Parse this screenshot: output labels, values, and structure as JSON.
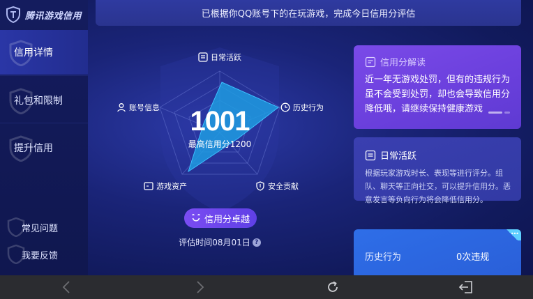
{
  "app": {
    "brand_name": "腾讯游戏信用"
  },
  "banner": {
    "text": "已根据你QQ账号下的在玩游戏，完成今日信用分评估"
  },
  "sidebar": {
    "items": [
      {
        "label": "信用详情",
        "active": true
      },
      {
        "label": "礼包和限制",
        "active": false
      },
      {
        "label": "提升信用",
        "active": false
      }
    ],
    "bottom_links": [
      {
        "label": "常见问题"
      },
      {
        "label": "我要反馈"
      }
    ]
  },
  "radar": {
    "score": "1001",
    "max_label": "最高信用分1200",
    "axes": [
      {
        "label": "日常活跃",
        "icon": "list-icon"
      },
      {
        "label": "历史行为",
        "icon": "clock-icon"
      },
      {
        "label": "安全贡献",
        "icon": "shield-icon"
      },
      {
        "label": "游戏资产",
        "icon": "wallet-icon"
      },
      {
        "label": "账号信息",
        "icon": "user-icon"
      }
    ],
    "grade_button": "信用分卓越",
    "eval_time": "评估时间08月01日",
    "help_symbol": "?"
  },
  "cards": {
    "interpret": {
      "title": "信用分解读",
      "body": "近一年无游戏处罚，但有的违规行为虽不会受到处罚，却也会导致信用分降低哦，请继续保持健康游戏"
    },
    "daily": {
      "title": "日常活跃",
      "body": "根据玩家游戏时长、表现等进行评分。组队、聊天等正向社交，可以提升信用分。恶意发言等负向行为将会降低信用分。"
    },
    "history": {
      "label": "历史行为",
      "value": "0次违规",
      "corner": "•••"
    }
  },
  "navbar": {
    "buttons": [
      "back-icon",
      "forward-icon",
      "refresh-icon",
      "exit-icon"
    ]
  },
  "colors": {
    "accent_purple": "#6a3fdc",
    "radar_fill": "#1e9be0",
    "card_blue": "#2a5fd8"
  }
}
